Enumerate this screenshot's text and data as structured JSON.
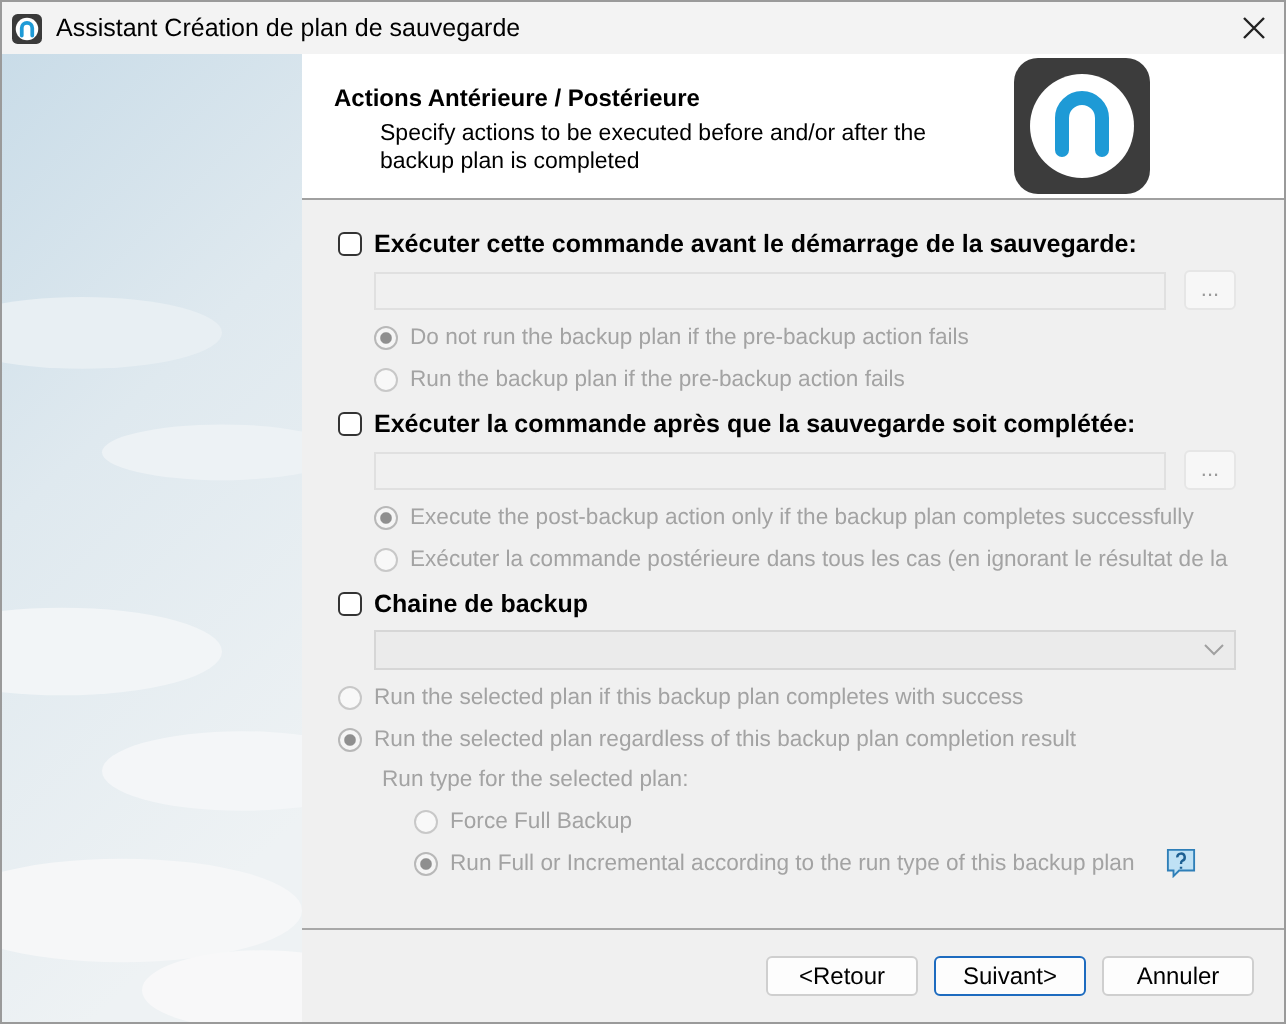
{
  "window": {
    "title": "Assistant Création de plan de sauvegarde"
  },
  "header": {
    "title": "Actions Antérieure / Postérieure",
    "subtitle": "Specify actions to be executed before and/or after the backup plan is completed"
  },
  "sections": [
    {
      "kind": "command",
      "label": "Exécuter cette commande avant le démarrage de la sauvegarde:",
      "checked": false,
      "disabled": true,
      "browse": "...",
      "options": [
        {
          "label": "Do not run the backup plan if the pre-backup action fails",
          "selected": true
        },
        {
          "label": "Run the backup plan if the pre-backup action fails",
          "selected": false
        }
      ]
    },
    {
      "kind": "command",
      "label": "Exécuter la commande après que la sauvegarde soit complétée:",
      "checked": false,
      "disabled": true,
      "browse": "...",
      "options": [
        {
          "label": "Execute the post-backup action only if the backup plan completes successfully",
          "selected": true
        },
        {
          "label": "Exécuter la commande postérieure dans tous les cas (en ignorant le résultat de la",
          "selected": false
        }
      ]
    },
    {
      "kind": "chain",
      "label": "Chaine de backup",
      "checked": false,
      "disabled": true,
      "options": [
        {
          "label": "Run the selected plan if this backup plan completes with success",
          "selected": false
        },
        {
          "label": "Run the selected plan regardless of this backup plan completion result",
          "selected": true
        }
      ],
      "sub_label": "Run type for the selected plan:",
      "sub_options": [
        {
          "label": "Force Full Backup",
          "selected": false
        },
        {
          "label": "Run Full or Incremental according to the run type of this backup plan",
          "selected": true
        }
      ]
    }
  ],
  "buttons": [
    {
      "label": "<Retour",
      "default": false
    },
    {
      "label": "Suivant>",
      "default": true
    },
    {
      "label": "Annuler",
      "default": false
    }
  ]
}
